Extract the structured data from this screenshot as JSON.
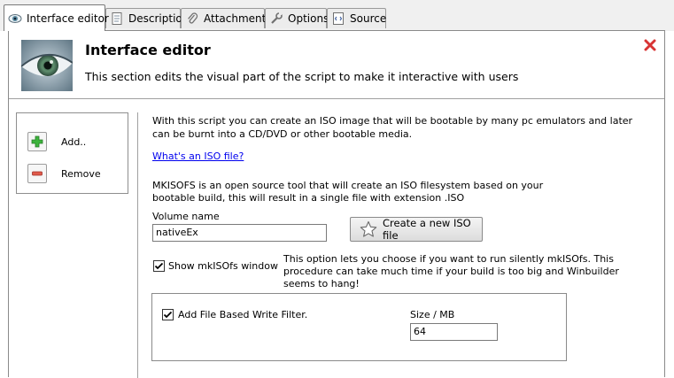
{
  "tabs": [
    {
      "label": "Interface editor",
      "icon": "eye-icon",
      "active": true
    },
    {
      "label": "Description",
      "icon": "document-icon",
      "active": false
    },
    {
      "label": "Attachments",
      "icon": "paperclip-icon",
      "active": false
    },
    {
      "label": "Options",
      "icon": "wrench-icon",
      "active": false
    },
    {
      "label": "Source",
      "icon": "code-icon",
      "active": false
    }
  ],
  "header": {
    "title": "Interface editor",
    "description": "This section edits the visual part of the script to make it interactive with users",
    "close_icon": "close-icon"
  },
  "tools": {
    "add_label": "Add..",
    "remove_label": "Remove"
  },
  "content": {
    "intro_line1": "With this script you can create an ISO image that will be bootable by many pc emulators and later",
    "intro_line2": "can be burnt into a CD/DVD or other bootable media.",
    "link_text": "What's an ISO file?",
    "mkisofs_line1": "MKISOFS is an open source tool that will create an ISO filesystem based on your",
    "mkisofs_line2": "bootable build, this will result in a single file with extension .ISO",
    "volume_label": "Volume name",
    "volume_value": "nativeEx",
    "create_button": "Create a new ISO file",
    "show_window_label": "Show mkISOfs window",
    "show_window_checked": true,
    "option_line1": "This option lets you choose if you want to run silently mkISOfs. This",
    "option_line2": "procedure can take much time if your build is too big and Winbuilder",
    "option_line3": "seems to hang!",
    "filter_label": "Add File Based Write Filter.",
    "filter_checked": true,
    "size_label": "Size / MB",
    "size_value": "64"
  },
  "colors": {
    "link": "#0000ee",
    "close_red": "#d83434",
    "add_green": "#3cb43c",
    "remove_red": "#e05a4a"
  }
}
